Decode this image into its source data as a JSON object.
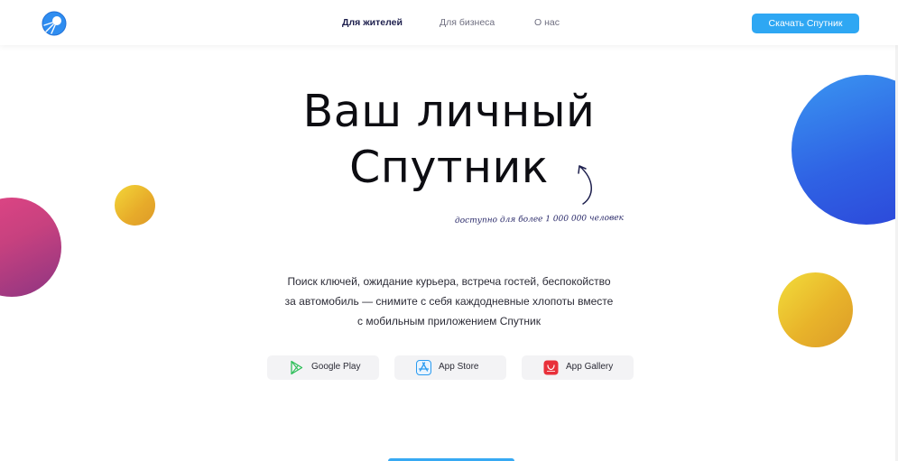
{
  "header": {
    "nav": [
      {
        "label": "Для жителей",
        "active": true
      },
      {
        "label": "Для бизнеса",
        "active": false
      },
      {
        "label": "О нас",
        "active": false
      }
    ],
    "download_label": "Скачать Спутник"
  },
  "hero": {
    "title_line1": "Ваш личный",
    "title_line2": "Спутник",
    "note": "доступно для более 1 000 000 человек",
    "description_line1": "Поиск ключей, ожидание курьера, встреча гостей, беспокойство",
    "description_line2": "за автомобиль — снимите с себя каждодневные хлопоты вместе",
    "description_line3": "с мобильным приложением Спутник"
  },
  "stores": [
    {
      "label": "Google Play",
      "icon": "google-play-icon"
    },
    {
      "label": "App Store",
      "icon": "app-store-icon"
    },
    {
      "label": "App Gallery",
      "icon": "app-gallery-icon"
    }
  ],
  "colors": {
    "accent": "#2ea7f3",
    "circle_blue": "#2f62e4",
    "circle_yellow": "#e8b32a",
    "circle_pink": "#c7417f"
  }
}
